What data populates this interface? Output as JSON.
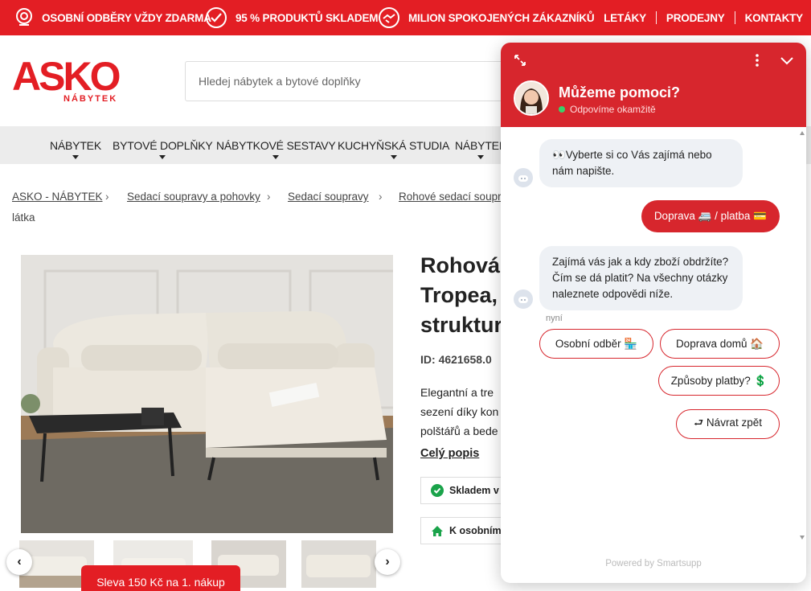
{
  "topbar": {
    "benefits": [
      {
        "label": "OSOBNÍ ODBĚRY VŽDY ZDARMA",
        "icon": "location-pin-icon"
      },
      {
        "label": "95 % PRODUKTŮ SKLADEM",
        "icon": "checkmark-circle-icon"
      },
      {
        "label": "MILION SPOKOJENÝCH ZÁKAZNÍKŮ",
        "icon": "handshake-icon"
      }
    ],
    "links": [
      "LETÁKY",
      "PRODEJNY",
      "KONTAKTY"
    ]
  },
  "header": {
    "logo": "ASKO",
    "logo_sub": "NÁBYTEK",
    "search_placeholder": "Hledej nábytek a bytové doplňky"
  },
  "nav": {
    "items": [
      "NÁBYTEK",
      "BYTOVÉ DOPLŇKY",
      "NÁBYTKOVÉ SESTAVY",
      "KUCHYŇSKÁ STUDIA",
      "NÁBYTEK"
    ]
  },
  "breadcrumb": {
    "items": [
      "ASKO - NÁBYTEK",
      "Sedací soupravy a pohovky",
      "Sedací soupravy",
      "Rohové sedací soupra"
    ],
    "tail": "látka"
  },
  "product": {
    "title_lines": [
      "Rohová",
      "Tropea,",
      "struktur"
    ],
    "id_label": "ID:",
    "id_value": "4621658.0",
    "desc_lines": [
      "Elegantní a tre",
      "sezení díky kon",
      "polštářů a bede"
    ],
    "more_label": "Celý popis",
    "stock_label": "Skladem v",
    "pickup_label": "K osobnímu",
    "promo": "Sleva 150 Kč na 1. nákup"
  },
  "chat": {
    "title": "Můžeme pomoci?",
    "status": "Odpovíme okamžitě",
    "messages": [
      "👀Vyberte si co Vás zajímá nebo nám napište.",
      "Zajímá vás jak a kdy zboží obdržíte? Čím se dá platit? Na všechny otázky naleznete odpovědi níže."
    ],
    "user_message": "Doprava 🚐 / platba 💳",
    "time": "nyní",
    "quick_replies": [
      "Osobní odběr 🏪",
      "Doprava domů 🏠",
      "Způsoby platby? 💲",
      "⮐ Návrat zpět"
    ],
    "powered": "Powered by Smartsupp"
  },
  "colors": {
    "brand": "#e31e24",
    "chat_red": "#d7262d"
  }
}
